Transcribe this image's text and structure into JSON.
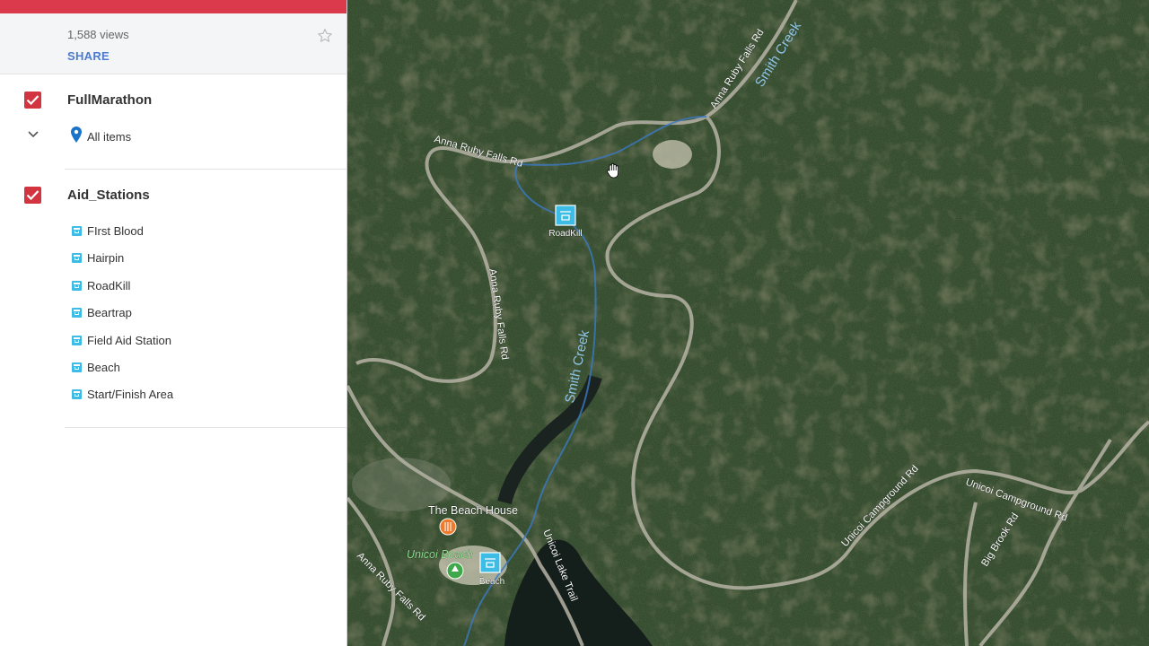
{
  "header": {
    "views": "1,588 views",
    "share_label": "SHARE"
  },
  "layers": [
    {
      "title": "FullMarathon",
      "checked": true,
      "all_items_label": "All items"
    },
    {
      "title": "Aid_Stations",
      "checked": true,
      "items": [
        {
          "label": "FIrst Blood"
        },
        {
          "label": "Hairpin"
        },
        {
          "label": "RoadKill"
        },
        {
          "label": "Beartrap"
        },
        {
          "label": "Field Aid Station"
        },
        {
          "label": "Beach"
        },
        {
          "label": "Start/Finish Area"
        }
      ]
    }
  ],
  "map": {
    "markers": [
      {
        "label": "RoadKill"
      },
      {
        "label": "Beach"
      }
    ],
    "places": [
      {
        "label": "The Beach House"
      },
      {
        "label": "Unicoi Beach"
      }
    ],
    "roads": [
      "Anna Ruby Falls Rd",
      "Anna Ruby Falls Rd",
      "Anna Ruby Falls Rd",
      "Anna Ruby Falls Rd",
      "Unicoi Campground Rd",
      "Unicoi Campground Rd",
      "Unicoi Lake Trail",
      "Big Brook Rd"
    ],
    "water": [
      "Smith Creek",
      "Smith Creek"
    ],
    "colors": {
      "forest": "#2c4124",
      "water": "#15201c",
      "aid_icon": "#3dbde6",
      "checkbox": "#d23440",
      "header_bar": "#db3a4c"
    }
  }
}
